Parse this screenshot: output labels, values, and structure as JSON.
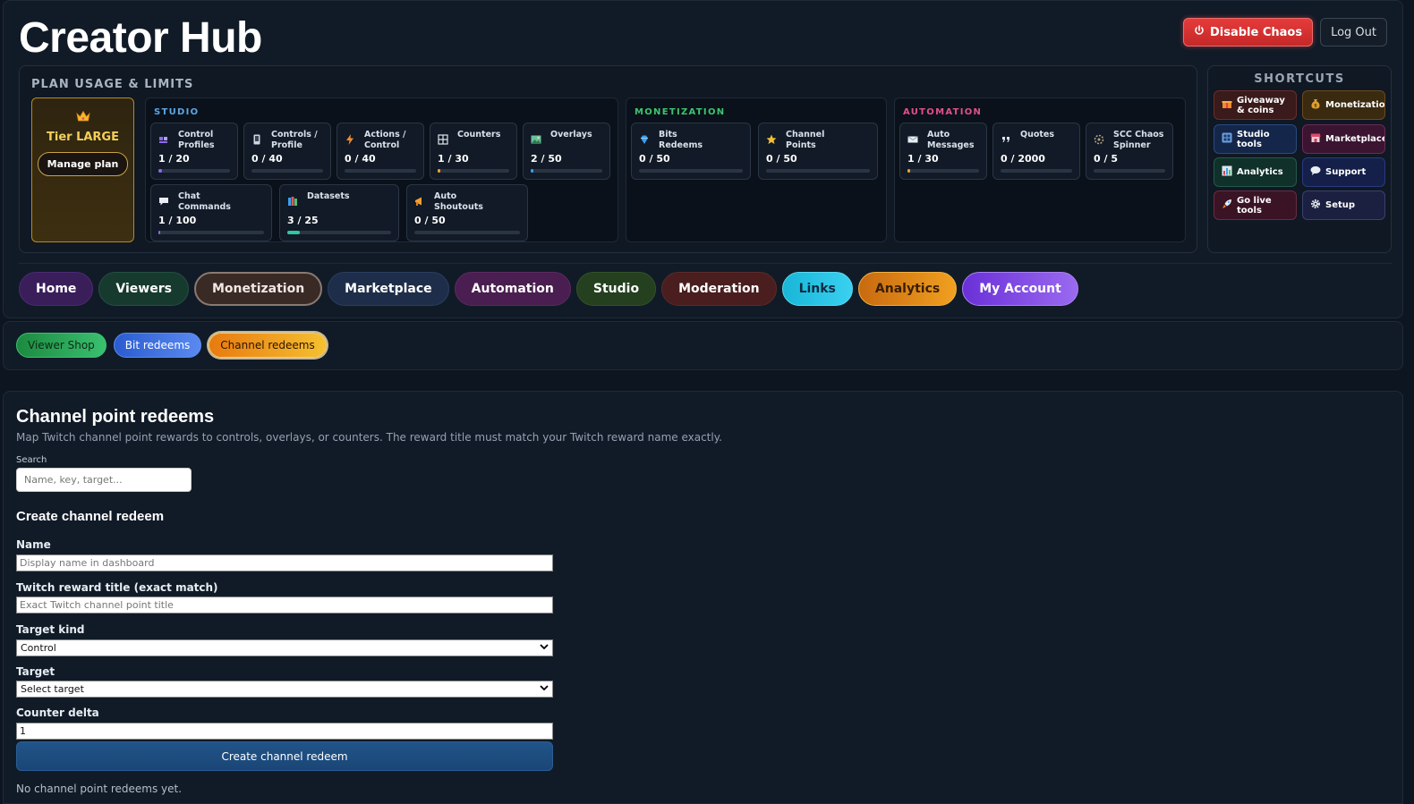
{
  "header": {
    "title": "Creator Hub",
    "disable_chaos": "Disable Chaos",
    "logout": "Log Out"
  },
  "usage": {
    "title": "PLAN USAGE & LIMITS",
    "tier": {
      "name": "Tier LARGE",
      "manage": "Manage plan"
    },
    "groups": {
      "studio": {
        "title": "STUDIO",
        "color": "#5aa7e6",
        "items": [
          {
            "label": "Control Profiles",
            "value": "1 / 20",
            "used": 1,
            "limit": 20,
            "color": "#8b6cf0",
            "icon": "users-icon"
          },
          {
            "label": "Controls / Profile",
            "value": "0 / 40",
            "used": 0,
            "limit": 40,
            "color": "#8b6cf0",
            "icon": "phone-icon"
          },
          {
            "label": "Actions / Control",
            "value": "0 / 40",
            "used": 0,
            "limit": 40,
            "color": "#f08c30",
            "icon": "bolt-icon"
          },
          {
            "label": "Counters",
            "value": "1 / 30",
            "used": 1,
            "limit": 30,
            "color": "#f0a030",
            "icon": "grid-icon"
          },
          {
            "label": "Overlays",
            "value": "2 / 50",
            "used": 2,
            "limit": 50,
            "color": "#3aa0f0",
            "icon": "image-icon"
          },
          {
            "label": "Chat Commands",
            "value": "1 / 100",
            "used": 1,
            "limit": 100,
            "color": "#8b6cf0",
            "icon": "chat-icon"
          },
          {
            "label": "Datasets",
            "value": "3 / 25",
            "used": 3,
            "limit": 25,
            "color": "#2cc7a0",
            "icon": "books-icon"
          },
          {
            "label": "Auto Shoutouts",
            "value": "0 / 50",
            "used": 0,
            "limit": 50,
            "color": "#8b6cf0",
            "icon": "megaphone-icon"
          }
        ]
      },
      "monetization": {
        "title": "MONETIZATION",
        "color": "#3ec46d",
        "items": [
          {
            "label": "Bits Redeems",
            "value": "0 / 50",
            "used": 0,
            "limit": 50,
            "color": "#3aa0f0",
            "icon": "diamond-icon"
          },
          {
            "label": "Channel Points",
            "value": "0 / 50",
            "used": 0,
            "limit": 50,
            "color": "#f0c030",
            "icon": "star-icon"
          }
        ]
      },
      "automation": {
        "title": "AUTOMATION",
        "color": "#e0508c",
        "items": [
          {
            "label": "Auto Messages",
            "value": "1 / 30",
            "used": 1,
            "limit": 30,
            "color": "#f0a030",
            "icon": "envelope-icon"
          },
          {
            "label": "Quotes",
            "value": "0 / 2000",
            "used": 0,
            "limit": 2000,
            "color": "#8b6cf0",
            "icon": "quote-icon"
          },
          {
            "label": "SCC Chaos Spinner",
            "value": "0 / 5",
            "used": 0,
            "limit": 5,
            "color": "#8b6cf0",
            "icon": "spinner-icon"
          }
        ]
      }
    }
  },
  "shortcuts": {
    "title": "SHORTCUTS",
    "items": [
      {
        "label": "Giveaway & coins",
        "icon": "gift-icon"
      },
      {
        "label": "Monetization",
        "icon": "money-bag-icon"
      },
      {
        "label": "Studio tools",
        "icon": "studio-icon"
      },
      {
        "label": "Marketplace",
        "icon": "store-icon"
      },
      {
        "label": "Analytics",
        "icon": "bar-chart-icon"
      },
      {
        "label": "Support",
        "icon": "speech-bubble-icon"
      },
      {
        "label": "Go live tools",
        "icon": "rocket-icon"
      },
      {
        "label": "Setup",
        "icon": "gear-icon"
      }
    ]
  },
  "nav": {
    "tabs": [
      {
        "label": "Home"
      },
      {
        "label": "Viewers"
      },
      {
        "label": "Monetization",
        "active": true
      },
      {
        "label": "Marketplace"
      },
      {
        "label": "Automation"
      },
      {
        "label": "Studio"
      },
      {
        "label": "Moderation"
      },
      {
        "label": "Links"
      },
      {
        "label": "Analytics"
      },
      {
        "label": "My Account"
      }
    ]
  },
  "subnav": {
    "tabs": [
      {
        "label": "Viewer Shop"
      },
      {
        "label": "Bit redeems"
      },
      {
        "label": "Channel redeems",
        "active": true
      }
    ]
  },
  "main": {
    "title": "Channel point redeems",
    "description": "Map Twitch channel point rewards to controls, overlays, or counters. The reward title must match your Twitch reward name exactly.",
    "search": {
      "label": "Search",
      "placeholder": "Name, key, target..."
    },
    "form": {
      "title": "Create channel redeem",
      "name_label": "Name",
      "name_placeholder": "Display name in dashboard",
      "reward_label": "Twitch reward title (exact match)",
      "reward_placeholder": "Exact Twitch channel point title",
      "kind_label": "Target kind",
      "kind_value": "Control",
      "target_label": "Target",
      "target_value": "Select target",
      "delta_label": "Counter delta",
      "delta_value": "1",
      "submit": "Create channel redeem"
    },
    "empty": "No channel point redeems yet."
  }
}
